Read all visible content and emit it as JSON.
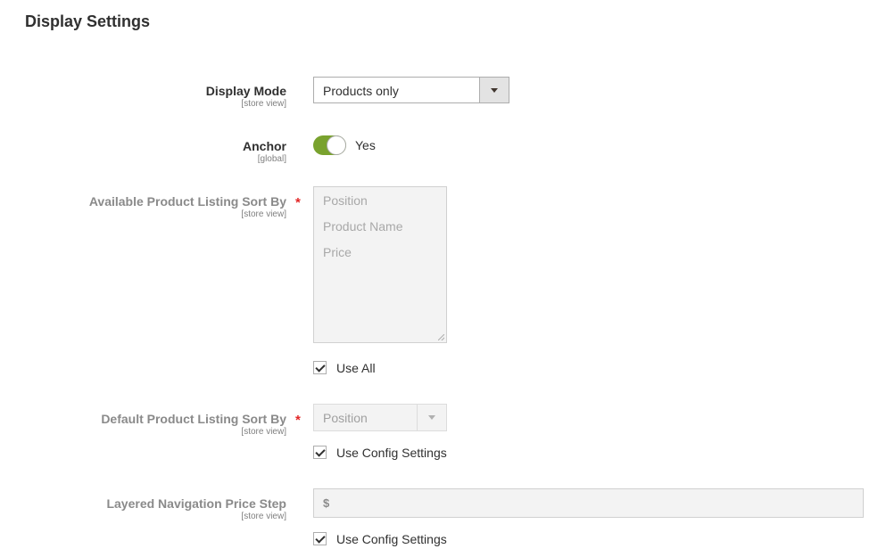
{
  "section": {
    "title": "Display Settings"
  },
  "fields": {
    "display_mode": {
      "label": "Display Mode",
      "scope": "[store view]",
      "value": "Products only"
    },
    "anchor": {
      "label": "Anchor",
      "scope": "[global]",
      "toggle_on": true,
      "value_label": "Yes"
    },
    "available_sort_by": {
      "label": "Available Product Listing Sort By",
      "scope": "[store view]",
      "required_mark": "*",
      "options": [
        "Position",
        "Product Name",
        "Price"
      ],
      "use_all_label": "Use All",
      "use_all_checked": true
    },
    "default_sort_by": {
      "label": "Default Product Listing Sort By",
      "scope": "[store view]",
      "required_mark": "*",
      "value": "Position",
      "use_config_label": "Use Config Settings",
      "use_config_checked": true
    },
    "price_step": {
      "label": "Layered Navigation Price Step",
      "scope": "[store view]",
      "currency_addon": "$",
      "value": "",
      "use_config_label": "Use Config Settings",
      "use_config_checked": true
    }
  },
  "colors": {
    "toggle_on": "#79a22e",
    "required": "#e22626",
    "disabled_bg": "#f3f3f3"
  }
}
